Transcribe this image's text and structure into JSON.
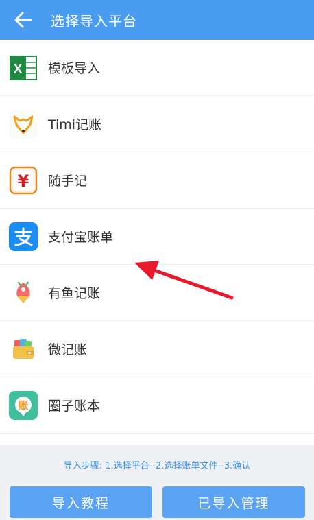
{
  "header": {
    "title": "选择导入平台"
  },
  "platforms": [
    {
      "label": "模板导入",
      "icon": "excel-icon"
    },
    {
      "label": "Timi记账",
      "icon": "timi-fox-icon"
    },
    {
      "label": "随手记",
      "icon": "yen-icon"
    },
    {
      "label": "支付宝账单",
      "icon": "alipay-icon"
    },
    {
      "label": "有鱼记账",
      "icon": "fish-icon"
    },
    {
      "label": "微记账",
      "icon": "wallet-icon"
    },
    {
      "label": "圈子账本",
      "icon": "circle-ledger-icon"
    }
  ],
  "footer": {
    "steps": "导入步骤: 1.选择平台--2.选择账单文件--3.确认",
    "tutorial_button": "导入教程",
    "manage_button": "已导入管理"
  },
  "colors": {
    "primary": "#4a9cf0",
    "button": "#5aa3f2",
    "annotation_arrow": "#e8192c"
  }
}
